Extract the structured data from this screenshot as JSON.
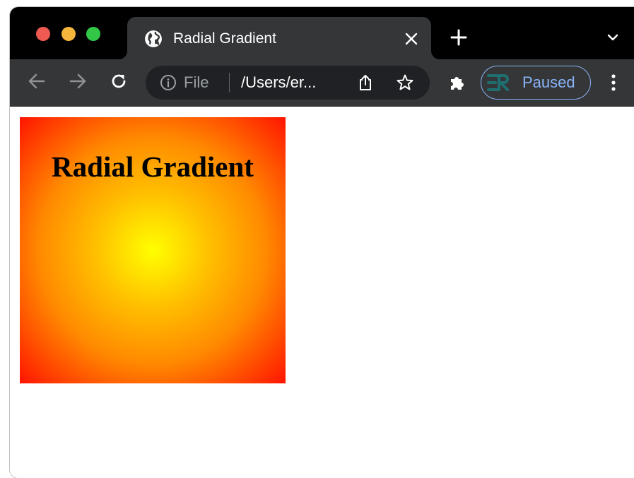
{
  "window": {
    "traffic_lights": [
      "close",
      "minimize",
      "zoom"
    ]
  },
  "tab": {
    "title": "Radial Gradient",
    "favicon": "globe-icon",
    "close_icon": "close-icon"
  },
  "tabstrip": {
    "new_tab_icon": "plus-icon",
    "tab_search_icon": "chevron-down-icon"
  },
  "toolbar": {
    "back_icon": "back-arrow-icon",
    "forward_icon": "forward-arrow-icon",
    "reload_icon": "reload-icon",
    "omnibox": {
      "info_icon": "info-icon",
      "scheme_label": "File",
      "url": "/Users/er...",
      "share_icon": "share-icon",
      "bookmark_icon": "star-icon"
    },
    "extensions_icon": "puzzle-piece-icon",
    "profile": {
      "label": "Paused",
      "avatar": "profile-avatar-icon"
    },
    "menu_icon": "kebab-menu-icon"
  },
  "page": {
    "heading": "Radial Gradient",
    "gradient_colors": [
      "#ffff00",
      "#ffc000",
      "#ff8a00",
      "#ff1400"
    ]
  },
  "colors": {
    "tabstrip_bg": "#000000",
    "toolbar_bg": "#353638",
    "omnibox_bg": "#202124",
    "profile_accent": "#8ab4f8"
  }
}
